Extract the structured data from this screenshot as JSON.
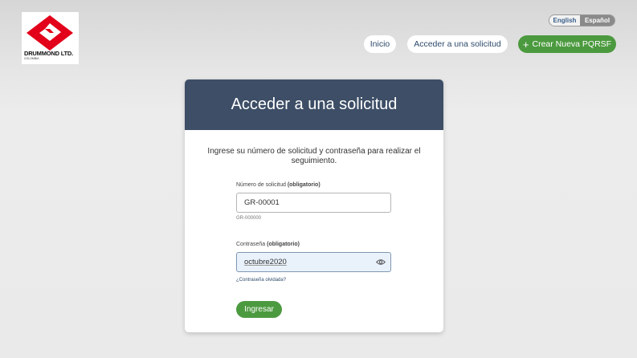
{
  "brand": {
    "name": "DRUMMOND LTD.",
    "sub": "COLOMBIA"
  },
  "lang": {
    "english": "English",
    "spanish": "Español"
  },
  "nav": {
    "inicio": "Inicio",
    "acceder": "Acceder a una solicitud",
    "crear": "Crear Nueva PQRSF"
  },
  "card": {
    "title": "Acceder a una solicitud",
    "intro": "Ingrese su número de solicitud y contraseña para realizar el seguimiento.",
    "request_label": "Número de solicitud",
    "request_required": "(obligatorio)",
    "request_value": "GR-00001",
    "request_hint": "GR-000000",
    "password_label": "Contraseña",
    "password_required": "(obligatorio)",
    "password_value": "octubre2020",
    "forgot": "¿Contraseña olvidada?",
    "submit": "Ingresar"
  },
  "colors": {
    "header": "#3d4e66",
    "green": "#4c9a3f",
    "logo_red": "#e2001a"
  }
}
